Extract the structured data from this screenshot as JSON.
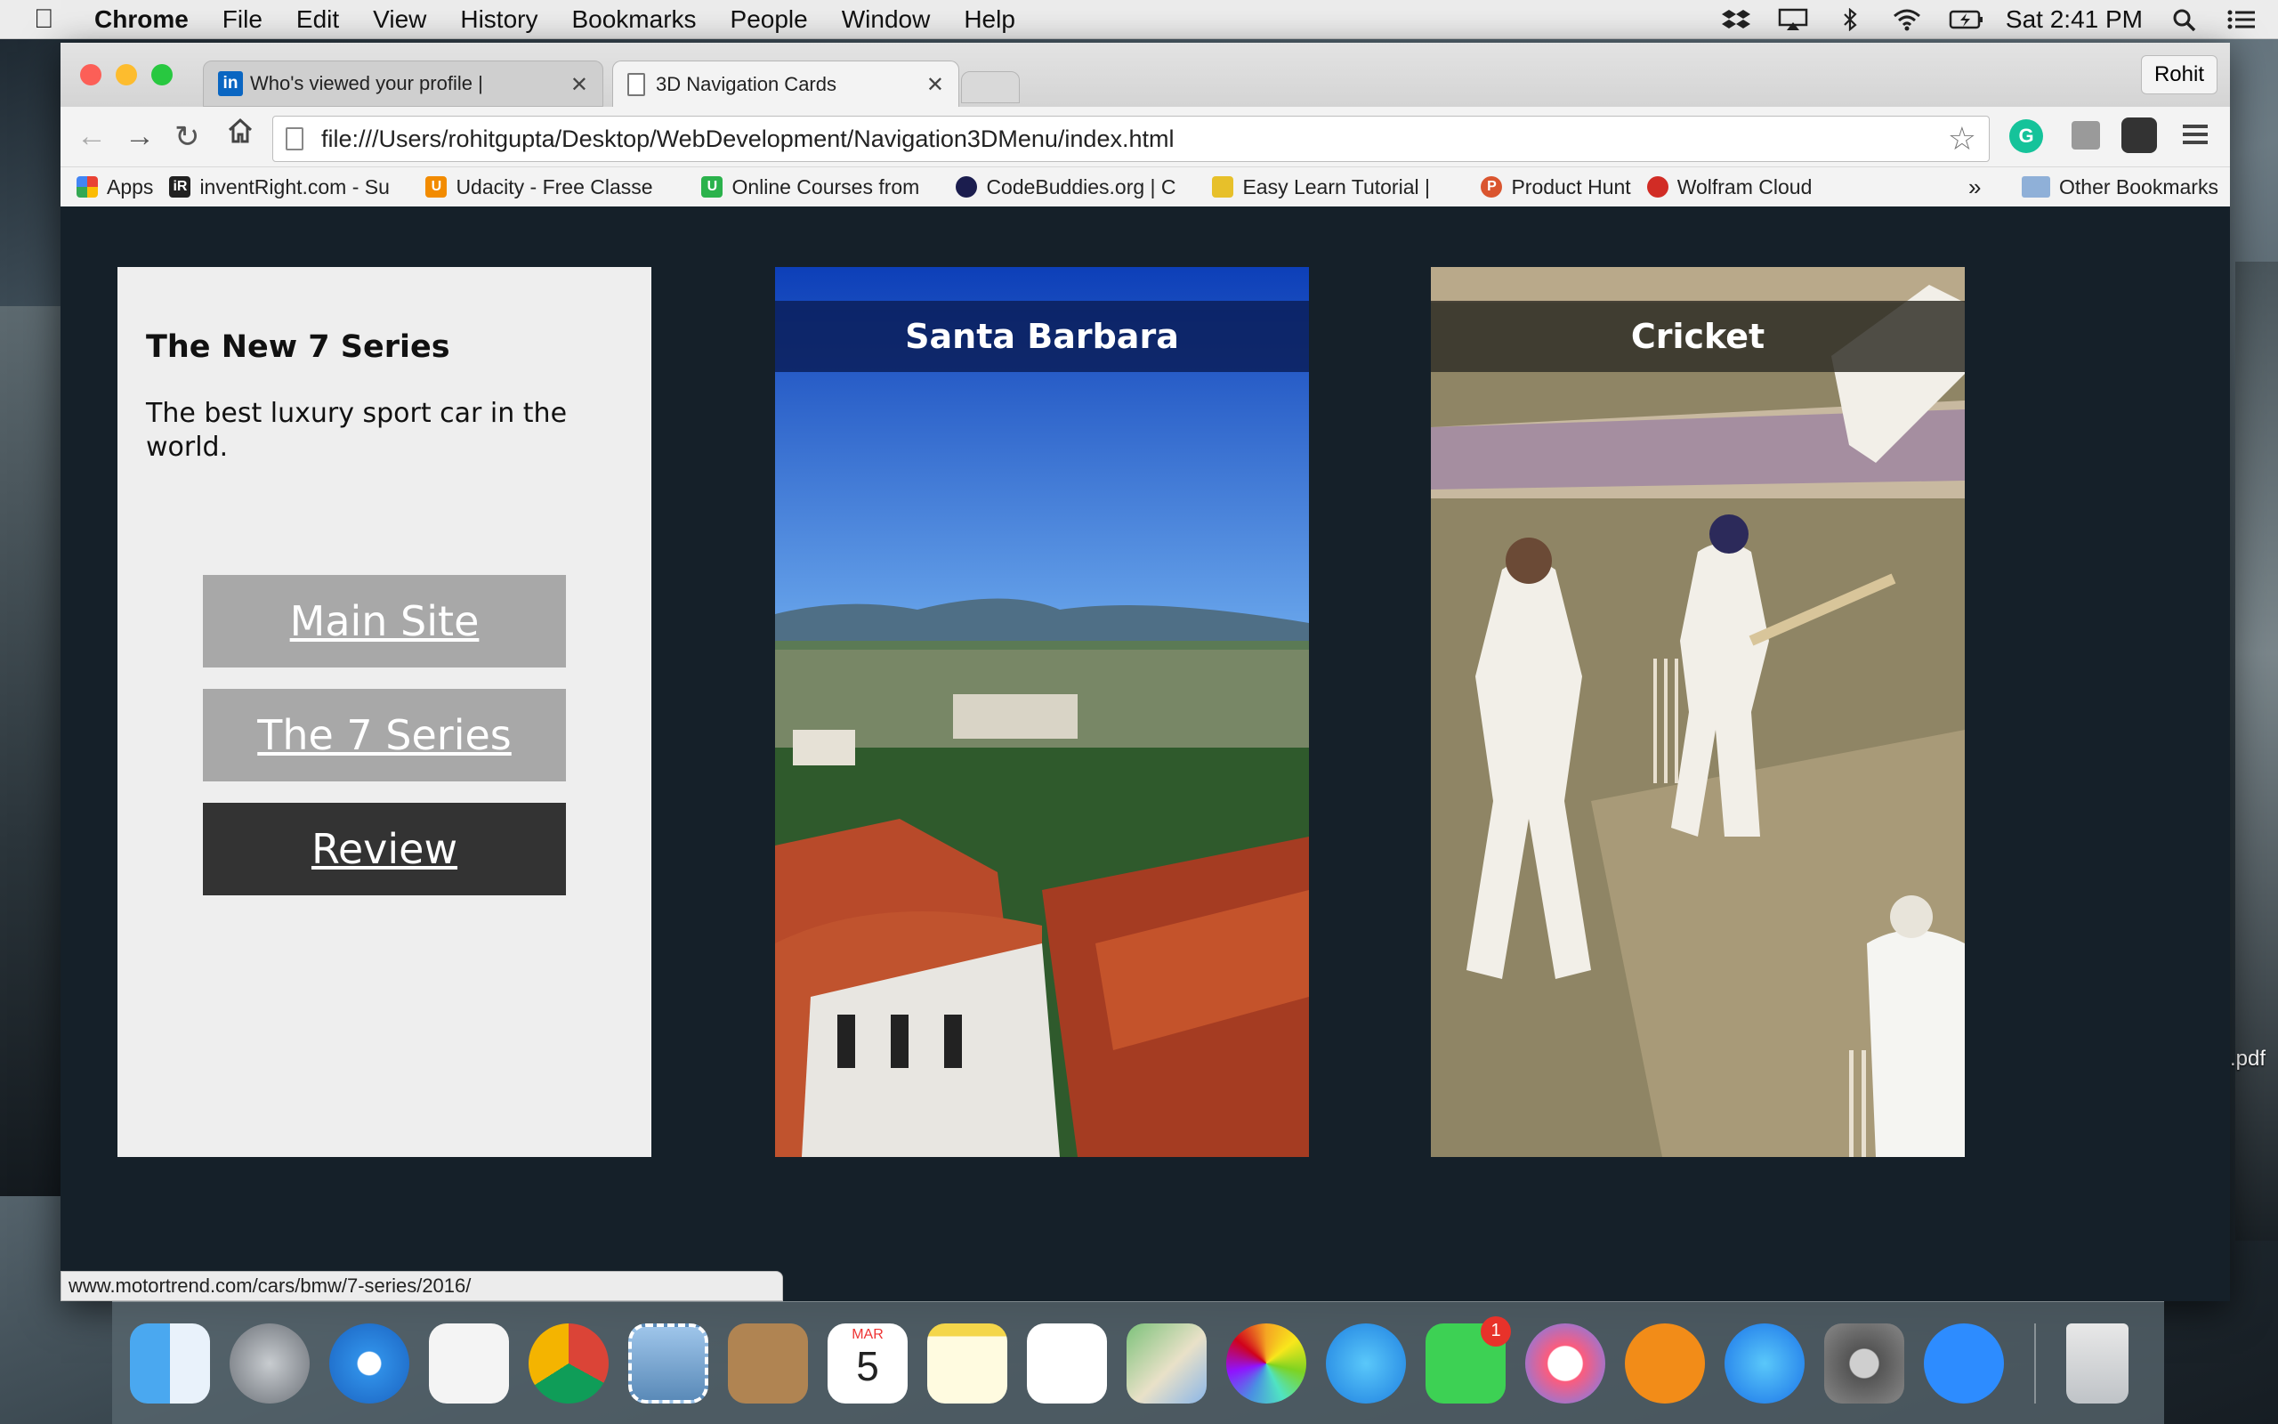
{
  "menubar": {
    "app": "Chrome",
    "menus": [
      "File",
      "Edit",
      "View",
      "History",
      "Bookmarks",
      "People",
      "Window",
      "Help"
    ],
    "clock": "Sat 2:41 PM"
  },
  "browser": {
    "tabs": [
      {
        "title": "Who's viewed your profile |",
        "favicon": "linkedin-icon"
      },
      {
        "title": "3D Navigation Cards",
        "favicon": "page-icon"
      }
    ],
    "profile": "Rohit",
    "url": "file:///Users/rohitgupta/Desktop/WebDevelopment/Navigation3DMenu/index.html",
    "bookmarks": [
      {
        "label": "Apps",
        "color": "#e94235"
      },
      {
        "label": "inventRight.com - Su",
        "color": "#222222"
      },
      {
        "label": "Udacity - Free Classe",
        "color": "#f28b00"
      },
      {
        "label": "Online Courses from",
        "color": "#2bb24c"
      },
      {
        "label": "CodeBuddies.org | C",
        "color": "#1b1d4e"
      },
      {
        "label": "Easy Learn Tutorial |",
        "color": "#e7c02a"
      },
      {
        "label": "Product Hunt",
        "color": "#da552f"
      },
      {
        "label": "Wolfram Cloud",
        "color": "#d12c25"
      }
    ],
    "overflow": "»",
    "other_bookmarks": "Other Bookmarks",
    "status_url": "www.motortrend.com/cars/bmw/7-series/2016/"
  },
  "page": {
    "card1": {
      "title": "The New 7 Series",
      "text": "The best luxury sport car in the world.",
      "buttons": [
        {
          "label": "Main Site",
          "color": "#a8a8a8"
        },
        {
          "label": "The 7 Series",
          "color": "#a8a8a8"
        },
        {
          "label": "Review",
          "color": "#333333"
        }
      ]
    },
    "card2": {
      "title": "Santa Barbara"
    },
    "card3": {
      "title": "Cricket"
    }
  },
  "desktop": {
    "file_label": ".pdf"
  },
  "dock": {
    "calendar_month": "MAR",
    "calendar_day": "5",
    "facetime_badge": "1"
  }
}
